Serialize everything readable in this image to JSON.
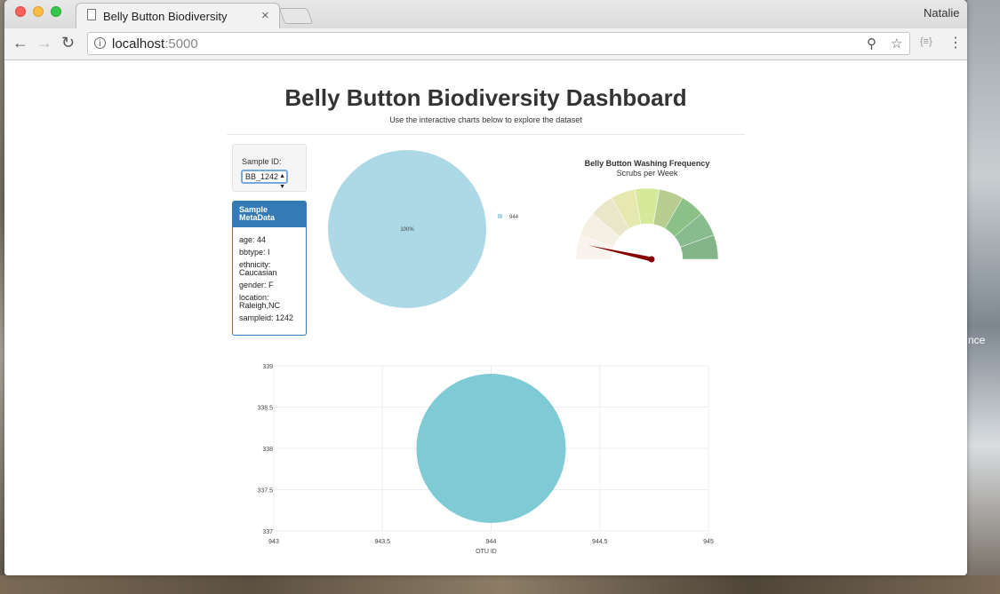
{
  "browser": {
    "tab_title": "Belly Button Biodiversity",
    "tab_close": "×",
    "profile_name": "Natalie",
    "url_host": "localhost",
    "url_port": ":5000"
  },
  "desktop": {
    "edge_text": "nce"
  },
  "page": {
    "title": "Belly Button Biodiversity Dashboard",
    "subtitle": "Use the interactive charts below to explore the dataset"
  },
  "sample_selector": {
    "label": "Sample ID:",
    "selected": "BB_1242"
  },
  "metadata": {
    "heading": "Sample MetaData",
    "items": [
      "age: 44",
      "bbtype: I",
      "ethnicity: Caucasian",
      "gender: F",
      "location: Raleigh,NC",
      "sampleid: 1242"
    ]
  },
  "chart_data": [
    {
      "type": "pie",
      "labels": [
        "944"
      ],
      "values": [
        100
      ],
      "slice_label": "100%",
      "legend": [
        "944"
      ],
      "colors": [
        "#add8e6"
      ]
    },
    {
      "type": "gauge",
      "title": "Belly Button Washing Frequency",
      "subtitle": "Scrubs per Week",
      "range": [
        0,
        9
      ],
      "steps": 9,
      "value": 1,
      "colors": [
        "#f8f3ec",
        "#f4f1e4",
        "#e9e6ca",
        "#e5e9b0",
        "#d5e99a",
        "#b7cd8f",
        "#8bc086",
        "#88bb8d",
        "#84b589"
      ],
      "needle_color": "#850000"
    },
    {
      "type": "scatter",
      "series": [
        {
          "x": [
            944
          ],
          "y": [
            338
          ],
          "marker_color": "#7ecbd6"
        }
      ],
      "xlabel": "OTU ID",
      "xlim": [
        943,
        945
      ],
      "ylim": [
        337,
        339
      ],
      "x_ticks": [
        "943",
        "943.5",
        "944",
        "944.5",
        "945"
      ],
      "y_ticks": [
        "337",
        "337.5",
        "338",
        "338.5",
        "339"
      ]
    }
  ]
}
